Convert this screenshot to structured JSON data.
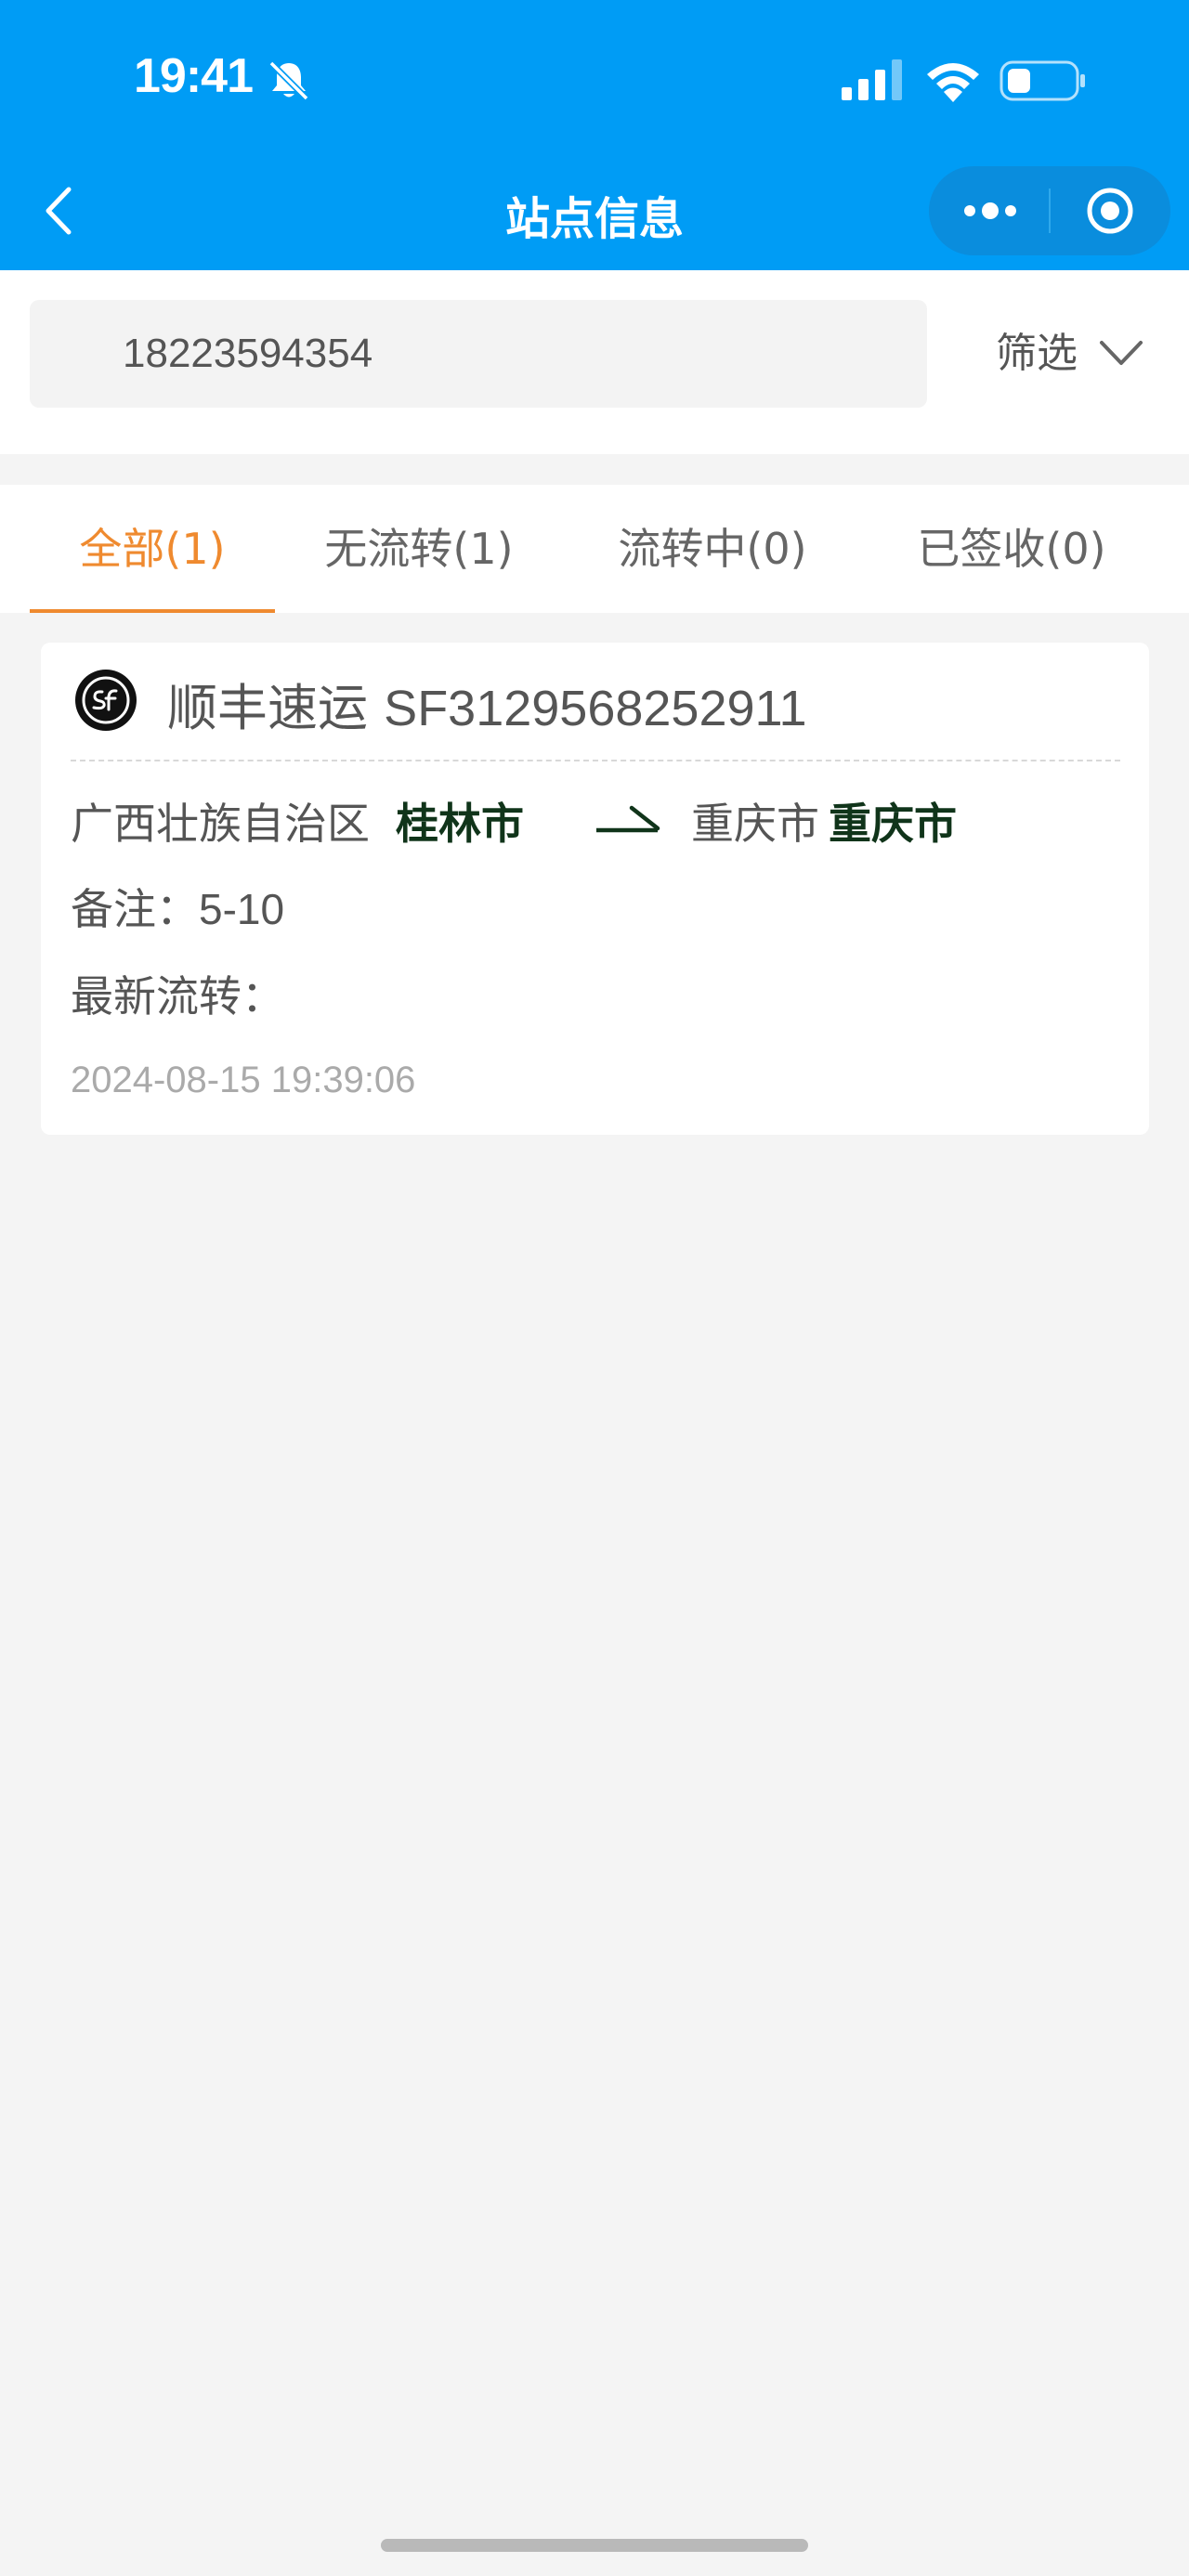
{
  "status_bar": {
    "time": "19:41",
    "icons": [
      "bell-slash-icon",
      "signal-icon",
      "wifi-icon",
      "battery-icon"
    ]
  },
  "nav": {
    "title": "站点信息",
    "back_icon": "chevron-left-icon",
    "capsule_icons": [
      "more-dots-icon",
      "target-close-icon"
    ]
  },
  "search": {
    "value": "18223594354",
    "filter_label": "筛选",
    "filter_icon": "chevron-down-icon"
  },
  "tabs": [
    {
      "label": "全部(1)",
      "active": true
    },
    {
      "label": "无流转(1)",
      "active": false
    },
    {
      "label": "流转中(0)",
      "active": false
    },
    {
      "label": "已签收(0)",
      "active": false
    }
  ],
  "shipment": {
    "courier_icon": "sf-express-logo-icon",
    "courier": "顺丰速运",
    "tracking_no": "SF3129568252911",
    "origin_province": "广西壮族自治区",
    "origin_city": "桂林市",
    "dest_province": "重庆市",
    "dest_city": "重庆市",
    "note_label": "备注：",
    "note_value": "5-10",
    "latest_label": "最新流转：",
    "timestamp": "2024-08-15 19:39:06"
  },
  "colors": {
    "header_bg": "#009cf5",
    "capsule_bg": "#0a8ddd",
    "active_tab": "#ef8a2f",
    "city_text": "#10341a",
    "page_bg": "#f4f4f4"
  }
}
